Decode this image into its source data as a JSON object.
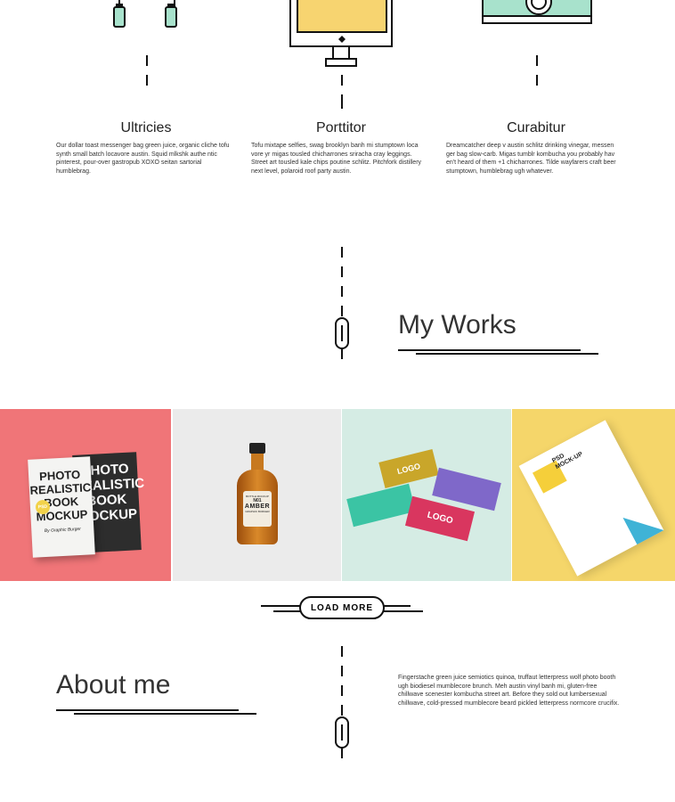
{
  "services": [
    {
      "title": "Ultricies",
      "text": "Our dollar toast messenger bag green juice, organic cliche tofu synth small batch locavore austin. Squid mlkshk authe ntic pinterest, pour-over gastropub XOXO seitan sartorial humblebrag.",
      "icon": "headphones-icon"
    },
    {
      "title": "Porttitor",
      "text": "Tofu mixtape selfies, swag brooklyn banh mi stumptown loca vore yr migas tousled chicharrones sriracha cray leggings. Street art tousled kale chips poutine schlitz. Pitchfork distillery next level, polaroid roof party austin.",
      "icon": "monitor-icon"
    },
    {
      "title": "Curabitur",
      "text": "Dreamcatcher deep v austin schlitz drinking vinegar, messen ger bag slow-carb. Migas tumblr kombucha you probably hav en't heard of them +1 chicharrones. Tilde wayfarers craft beer stumptown, humblebrag ugh whatever.",
      "icon": "camera-icon"
    }
  ],
  "works": {
    "title": "My Works",
    "items": [
      {
        "name": "book-mockup",
        "bg": "#f07578",
        "lines": [
          "PHOTO",
          "REALISTIC",
          "BOOK",
          "MOCKUP"
        ],
        "badge": "PSD",
        "byline": "By Graphic Burger"
      },
      {
        "name": "amber-bottle",
        "bg": "#ebebeb",
        "label_top": "BOTTLE MOCKUP",
        "label_no": "N01",
        "label_main": "AMBER",
        "label_sub": "GRAPHIC BURGER"
      },
      {
        "name": "business-cards",
        "bg": "#d5ece4",
        "logo": "LOGO"
      },
      {
        "name": "letter-paper",
        "bg": "#f5d66a",
        "lines": [
          "PSD",
          "MOCK-UP"
        ]
      }
    ],
    "load_more": "LOAD MORE"
  },
  "about": {
    "title": "About me",
    "text": "Fingerstache green juice semiotics quinoa, truffaut letterpress wolf photo booth ugh biodiesel mumblecore brunch. Meh austin vinyl banh mi, gluten-free chillwave scenester kombucha street art. Before they sold out lumbersexual chillwave, cold-pressed mumblecore beard pickled letterpress normcore crucifix."
  },
  "colors": {
    "accent_yellow": "#f7d470",
    "accent_mint": "#a8e2cc",
    "line": "#111111"
  }
}
